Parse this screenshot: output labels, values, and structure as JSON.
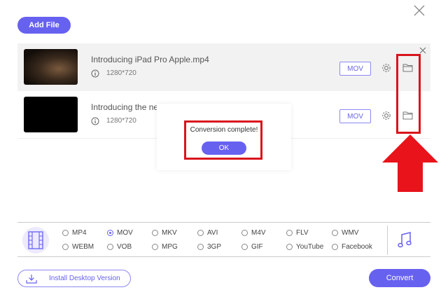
{
  "header": {
    "add_file_label": "Add File"
  },
  "files": [
    {
      "name": "Introducing iPad Pro Apple.mp4",
      "resolution": "1280*720",
      "format": "MOV"
    },
    {
      "name": "Introducing the ne",
      "resolution": "1280*720",
      "format": "MOV"
    }
  ],
  "dialog": {
    "message": "Conversion complete!",
    "ok_label": "OK"
  },
  "formats": {
    "selected": "MOV",
    "options_row1": [
      "MP4",
      "MOV",
      "MKV",
      "AVI",
      "M4V",
      "FLV",
      "WMV"
    ],
    "options_row2": [
      "WEBM",
      "VOB",
      "MPG",
      "3GP",
      "GIF",
      "YouTube",
      "Facebook"
    ]
  },
  "footer": {
    "install_label": "Install Desktop Version",
    "convert_label": "Convert"
  },
  "colors": {
    "accent": "#6761f0",
    "highlight": "#d9151c"
  }
}
